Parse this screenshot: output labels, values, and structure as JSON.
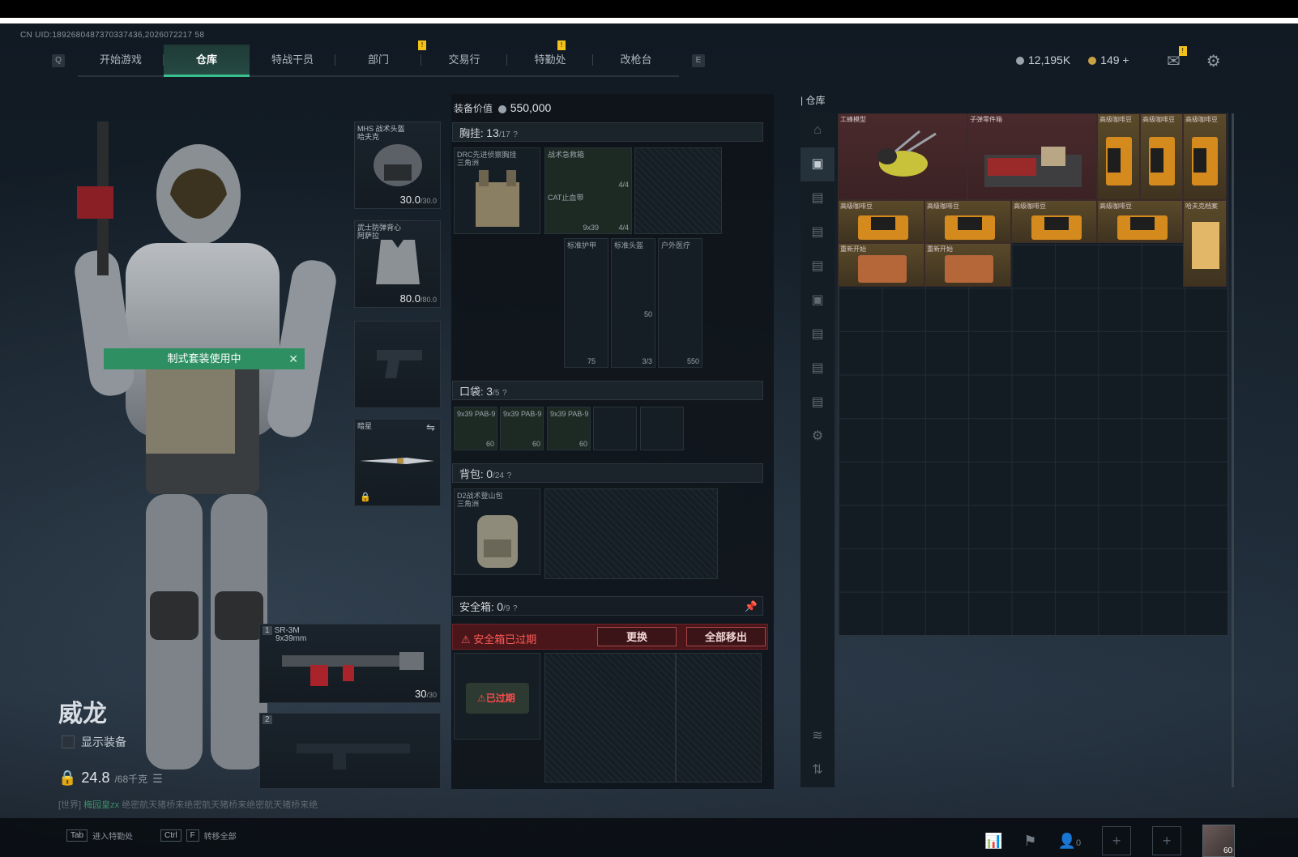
{
  "uid": "CN UID:1892680487370337436,2026072217 58",
  "nav": {
    "left_key": "Q",
    "right_key": "E",
    "tabs": [
      "开始游戏",
      "仓库",
      "特战干员",
      "部门",
      "交易行",
      "特勤处",
      "改枪台"
    ],
    "active_tab": "仓库"
  },
  "currency": {
    "silver": "12,195K",
    "gold": "149",
    "add": "+"
  },
  "character": {
    "banner": "制式套装使用中",
    "name": "威龙",
    "show_gear": "显示装备",
    "weight": "24.8",
    "weight_max": "/68千克",
    "chat_prefix": "[世界]",
    "chat_user": "梅园皇zx",
    "chat_text": "绝密航天猪桥来绝密航天猪桥来绝密航天猪桥来绝"
  },
  "equipment": {
    "helmet": {
      "label": "MHS 战术头盔",
      "sub": "哈夫克",
      "durability": "30.0",
      "max": "/30.0"
    },
    "armor": {
      "label": "武士防弹背心",
      "sub": "阿萨拉",
      "durability": "80.0",
      "max": "/80.0"
    },
    "melee": {
      "label": "暗星"
    },
    "primary": {
      "slot": "1",
      "name": "SR-3M",
      "caliber": "9x39mm",
      "ammo": "30",
      "ammo_max": "/30"
    },
    "secondary": {
      "slot": "2"
    }
  },
  "loadout": {
    "value_label": "装备价值",
    "value": "550,000",
    "chest": {
      "label": "胸挂:",
      "count": "13",
      "max": "/17"
    },
    "chest_item": "DRC先进侦察胸挂",
    "chest_item_sub": "三角洲",
    "chest_cells": [
      {
        "label": "战术急救箱",
        "count": "4/4"
      },
      {
        "label": "CAT止血带",
        "count": "4/4"
      },
      {
        "label": "9x39",
        "count": "30"
      }
    ],
    "sub_cells": [
      {
        "label": "标准护甲",
        "count": "75"
      },
      {
        "label": "标准头盔",
        "count": "50"
      },
      {
        "label": "户外医疗",
        "count": "550"
      },
      {
        "label": "",
        "count": "3/3"
      }
    ],
    "pocket": {
      "label": "口袋:",
      "count": "3",
      "max": "/5"
    },
    "pocket_items": [
      {
        "label": "9x39 PAB-9",
        "count": "60"
      },
      {
        "label": "9x39 PAB-9",
        "count": "60"
      },
      {
        "label": "9x39 PAB-9",
        "count": "60"
      }
    ],
    "backpack": {
      "label": "背包:",
      "count": "0",
      "max": "/24"
    },
    "backpack_item": "D2战术登山包",
    "backpack_item_sub": "三角洲",
    "safe": {
      "label": "安全箱:",
      "count": "0",
      "max": "/9"
    },
    "safe_expired": "安全箱已过期",
    "btn_replace": "更换",
    "btn_remove_all": "全部移出",
    "safe_item_status": "已过期"
  },
  "warehouse": {
    "title": "仓库",
    "items": [
      {
        "label": "工蜂模型"
      },
      {
        "label": "子弹零件箱"
      },
      {
        "label": "高级咖啡豆"
      },
      {
        "label": "高级咖啡豆"
      },
      {
        "label": "高级咖啡豆"
      },
      {
        "label": "高级咖啡豆"
      },
      {
        "label": "高级咖啡豆"
      },
      {
        "label": "高级咖啡豆"
      },
      {
        "label": "高级咖啡豆"
      },
      {
        "label": "哈夫克档案"
      },
      {
        "label": "重新开始"
      },
      {
        "label": "重新开始"
      }
    ]
  },
  "bottom": {
    "tab_key": "Tab",
    "tab_action": "进入特勤处",
    "ctrl_key": "Ctrl",
    "f_key": "F",
    "ctrl_action": "转移全部",
    "friends": "0",
    "level": "60"
  }
}
